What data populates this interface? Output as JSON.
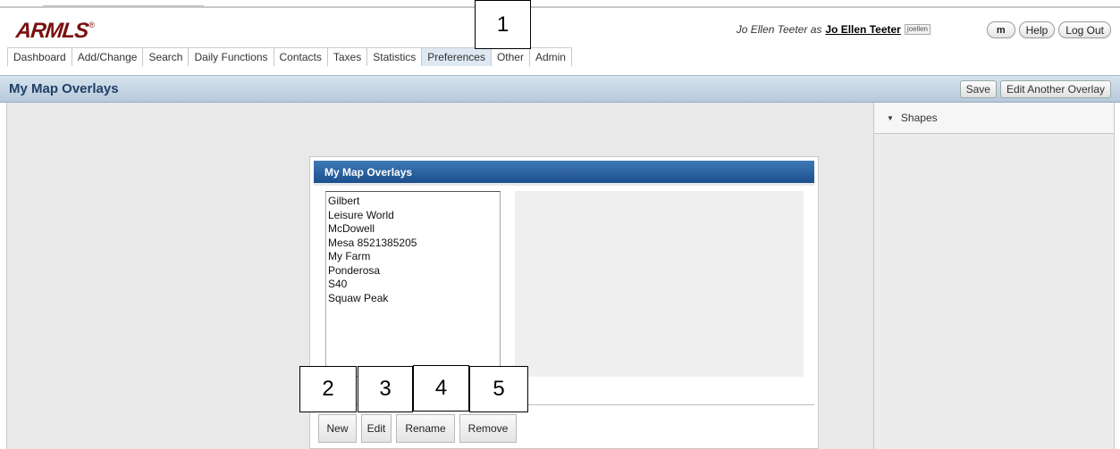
{
  "app": {
    "logo": "ARMLS",
    "logo_mark": "®"
  },
  "user": {
    "as_prefix": "Jo Ellen Teeter as",
    "name": "Jo Ellen Teeter",
    "id": "joellen"
  },
  "top_buttons": {
    "m_label": "m",
    "help_label": "Help",
    "logout_label": "Log Out"
  },
  "nav": {
    "tabs": [
      {
        "label": "Dashboard"
      },
      {
        "label": "Add/Change"
      },
      {
        "label": "Search"
      },
      {
        "label": "Daily Functions"
      },
      {
        "label": "Contacts"
      },
      {
        "label": "Taxes"
      },
      {
        "label": "Statistics"
      },
      {
        "label": "Preferences",
        "active": true
      },
      {
        "label": "Other"
      },
      {
        "label": "Admin"
      }
    ]
  },
  "page": {
    "title": "My Map Overlays",
    "save_label": "Save",
    "edit_another_label": "Edit Another Overlay"
  },
  "side_panel": {
    "shapes_label": "Shapes"
  },
  "dialog": {
    "title": "My Map Overlays",
    "overlays": [
      "Gilbert",
      "Leisure World",
      "McDowell",
      "Mesa 8521385205",
      "My Farm",
      "Ponderosa",
      "S40",
      "Squaw Peak"
    ],
    "buttons": {
      "new": "New",
      "edit": "Edit",
      "rename": "Rename",
      "remove": "Remove"
    }
  },
  "callouts": {
    "c1": "1",
    "c2": "2",
    "c3": "3",
    "c4": "4",
    "c5": "5"
  },
  "colors": {
    "brand": "#7a1010",
    "dialog_header": "#1b4f8e",
    "title_text": "#1f3f66"
  }
}
